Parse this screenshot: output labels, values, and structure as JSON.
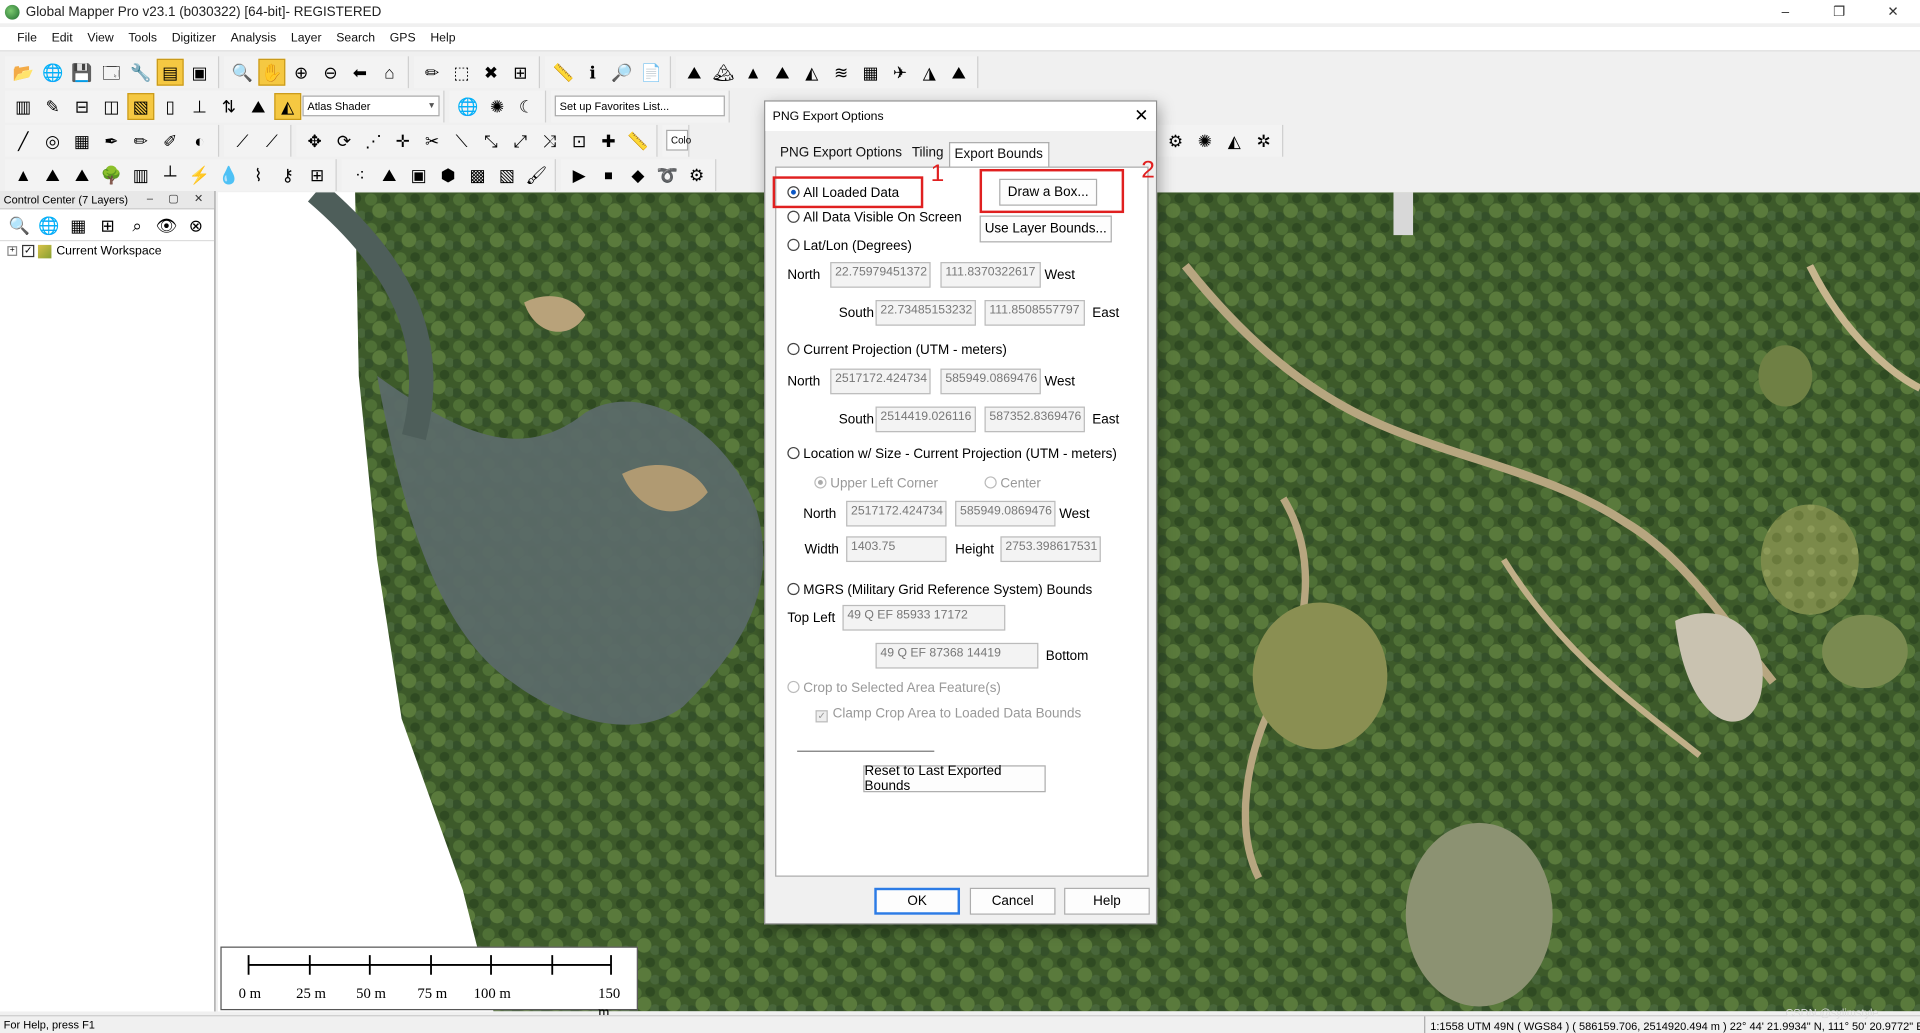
{
  "window": {
    "title": "Global Mapper Pro v23.1 (b030322) [64-bit]- REGISTERED",
    "min": "–",
    "max": "❐",
    "close": "✕"
  },
  "menu": [
    "File",
    "Edit",
    "View",
    "Tools",
    "Digitizer",
    "Analysis",
    "Layer",
    "Search",
    "GPS",
    "Help"
  ],
  "toolbar": {
    "shader_value": "Atlas Shader",
    "favorites_value": "Set up Favorites List...",
    "color_value": "Colo"
  },
  "control_center": {
    "title": "Control Center (7 Layers)",
    "header_buttons": "– ▢ ✕",
    "tree": [
      {
        "label": "Current Workspace",
        "expand": "+",
        "checked": "✓"
      }
    ]
  },
  "scale_bar": {
    "labels": [
      "0 m",
      "25 m",
      "50 m",
      "75 m",
      "100 m",
      "150 m"
    ]
  },
  "status": {
    "left": "For Help, press F1",
    "right": "1:1558  UTM 49N ( WGS84 ) ( 586159.706, 2514920.494 m )  22° 44' 21.9934\" N, 111° 50' 20.9772\" E",
    "watermark": "CSDN @sylimstyle"
  },
  "dialog": {
    "title": "PNG Export Options",
    "close": "✕",
    "tabs": [
      "PNG Export Options",
      "Tiling",
      "Export Bounds"
    ],
    "selected_tab": "Export Bounds",
    "options": {
      "all_loaded": "All Loaded Data",
      "all_visible": "All Data Visible On Screen",
      "latlon": "Lat/Lon (Degrees)",
      "current_proj": "Current Projection (UTM - meters)",
      "location_size": "Location w/ Size - Current Projection (UTM - meters)",
      "mgrs": "MGRS (Military Grid Reference System) Bounds",
      "crop": "Crop to Selected Area Feature(s)",
      "clamp": "Clamp Crop Area to Loaded Data Bounds",
      "upper_left": "Upper Left Corner",
      "center": "Center"
    },
    "buttons": {
      "draw_box": "Draw a Box...",
      "use_layer": "Use Layer Bounds...",
      "reset": "Reset to Last Exported Bounds",
      "ok": "OK",
      "cancel": "Cancel",
      "help": "Help"
    },
    "labels": {
      "north": "North",
      "south": "South",
      "west": "West",
      "east": "East",
      "width": "Width",
      "height": "Height",
      "top_left": "Top Left",
      "bottom": "Bottom"
    },
    "latlon": {
      "north": "22.75979451372",
      "west": "111.8370322617",
      "south": "22.73485153232",
      "east": "111.8508557797"
    },
    "proj": {
      "north": "2517172.424734",
      "west": "585949.0869476",
      "south": "2514419.026116",
      "east": "587352.8369476"
    },
    "locsize": {
      "north": "2517172.424734",
      "west": "585949.0869476",
      "width": "1403.75",
      "height": "2753.398617531"
    },
    "mgrs": {
      "top_left": "49 Q EF 85933 17172",
      "bottom": "49 Q EF 87368 14419"
    },
    "annotations": [
      "1",
      "2"
    ]
  }
}
